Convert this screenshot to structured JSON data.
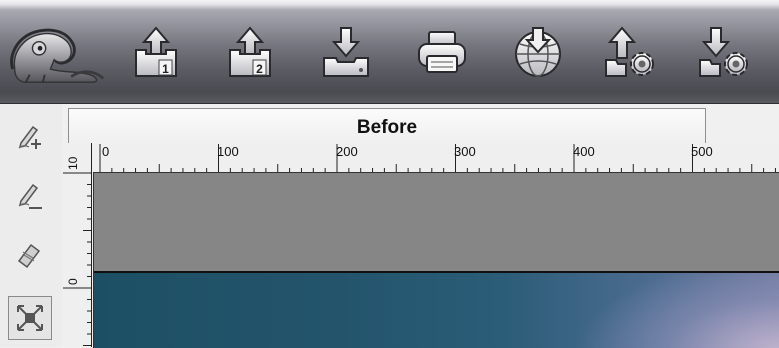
{
  "toolbar": {
    "buttons": [
      {
        "name": "logo",
        "icon": "chameleon-icon"
      },
      {
        "name": "import-first",
        "icon": "upload-icon",
        "badge": "1"
      },
      {
        "name": "import-second",
        "icon": "upload-icon",
        "badge": "2"
      },
      {
        "name": "save",
        "icon": "download-icon"
      },
      {
        "name": "print",
        "icon": "printer-icon"
      },
      {
        "name": "export-web",
        "icon": "globe-download-icon"
      },
      {
        "name": "import-settings",
        "icon": "upload-gear-icon"
      },
      {
        "name": "export-settings",
        "icon": "download-gear-icon"
      }
    ]
  },
  "sidebar": {
    "tools": [
      {
        "name": "add-marker",
        "icon": "pen-plus-icon"
      },
      {
        "name": "remove-marker",
        "icon": "pen-minus-icon"
      },
      {
        "name": "eraser",
        "icon": "eraser-icon"
      },
      {
        "name": "fit",
        "icon": "expand-arrows-icon"
      }
    ]
  },
  "tabs": [
    {
      "label": "Before",
      "active": true
    }
  ],
  "ruler": {
    "horizontal_labels": [
      "0",
      "100",
      "200",
      "300",
      "400",
      "500"
    ],
    "vertical_labels": [
      "10",
      "0"
    ]
  },
  "colors": {
    "toolbar_dark": "#4a4a51",
    "canvas_gray": "#868686",
    "photo_blue": "#23546c"
  }
}
